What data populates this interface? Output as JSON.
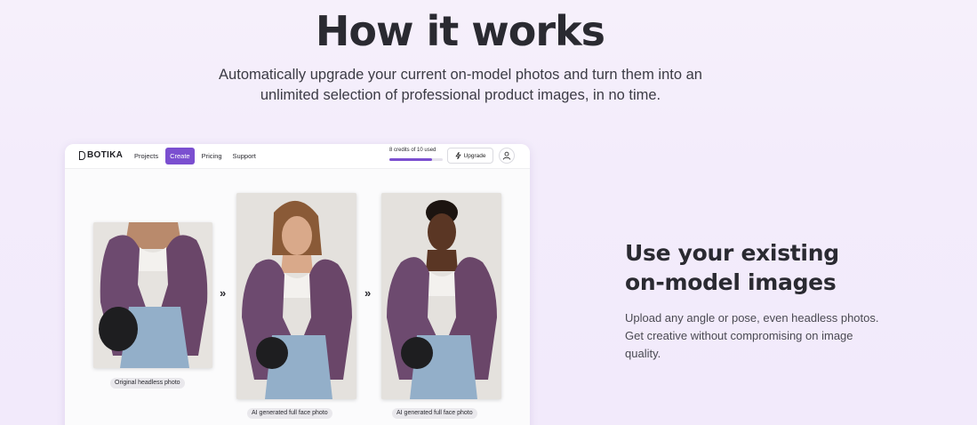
{
  "hero": {
    "title": "How it works",
    "subtitle": "Automatically upgrade your current on-model photos and turn them into an unlimited selection of professional product images, in no time."
  },
  "app": {
    "logo": "BOTIKA",
    "nav": [
      "Projects",
      "Create",
      "Pricing",
      "Support"
    ],
    "active_nav": "Create",
    "credits_text": "8 credits of 10 used",
    "credits_fraction": 0.8,
    "upgrade_label": "Upgrade",
    "accent_color": "#7b4fd0"
  },
  "steps": [
    {
      "caption": "Original headless photo",
      "icon": "person-headless-photo"
    },
    {
      "caption": "AI generated full face photo",
      "icon": "person-photo"
    },
    {
      "caption": "AI generated full face photo",
      "icon": "person-photo"
    }
  ],
  "arrow_glyph": "»",
  "feature": {
    "title": "Use your existing\non-model images",
    "description": "Upload any angle or pose, even headless photos. Get creative without compromising on image quality."
  }
}
